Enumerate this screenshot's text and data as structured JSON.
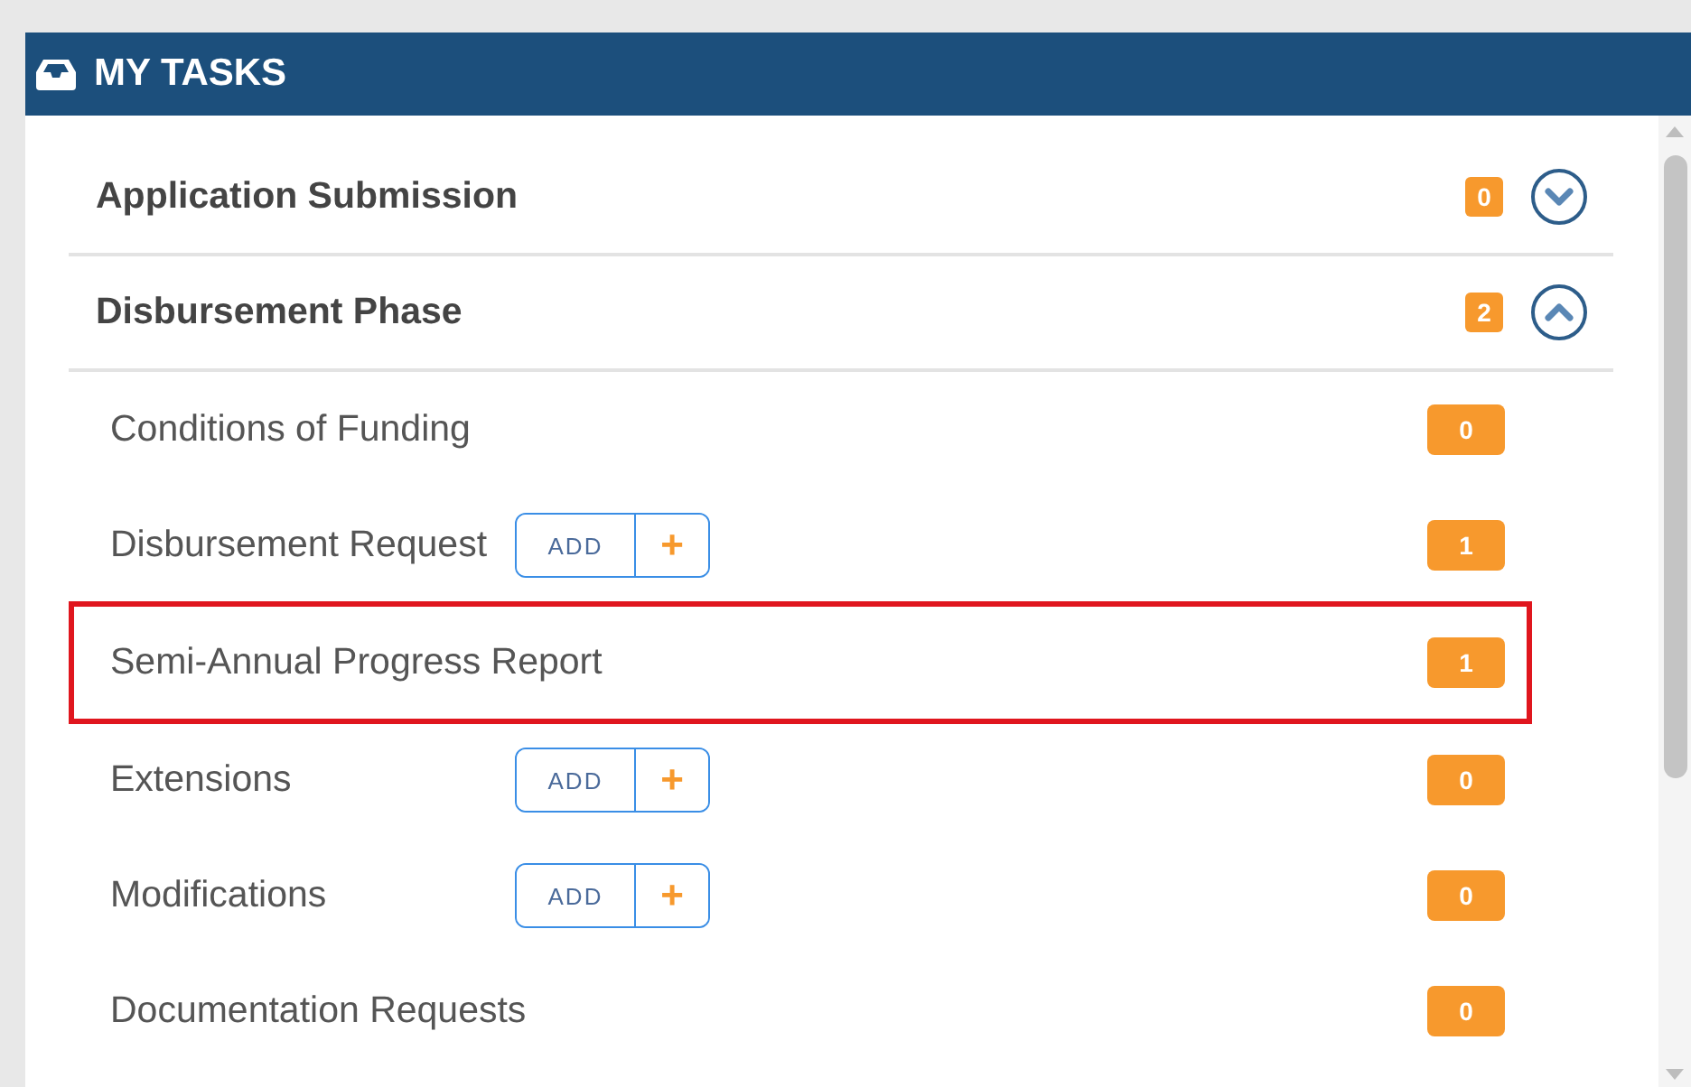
{
  "panel": {
    "title": "MY TASKS"
  },
  "sections": [
    {
      "title": "Application Submission",
      "count": "0",
      "expanded": false
    },
    {
      "title": "Disbursement Phase",
      "count": "2",
      "expanded": true,
      "items": [
        {
          "label": "Conditions of Funding",
          "count": "0",
          "add": false,
          "highlighted": false
        },
        {
          "label": "Disbursement Request",
          "count": "1",
          "add": true,
          "add_label": "ADD",
          "plus": "+",
          "highlighted": false
        },
        {
          "label": "Semi-Annual Progress Report",
          "count": "1",
          "add": false,
          "highlighted": true
        },
        {
          "label": "Extensions",
          "count": "0",
          "add": true,
          "add_label": "ADD",
          "plus": "+",
          "highlighted": false
        },
        {
          "label": "Modifications",
          "count": "0",
          "add": true,
          "add_label": "ADD",
          "plus": "+",
          "highlighted": false
        },
        {
          "label": "Documentation Requests",
          "count": "0",
          "add": false,
          "highlighted": false
        }
      ]
    }
  ]
}
